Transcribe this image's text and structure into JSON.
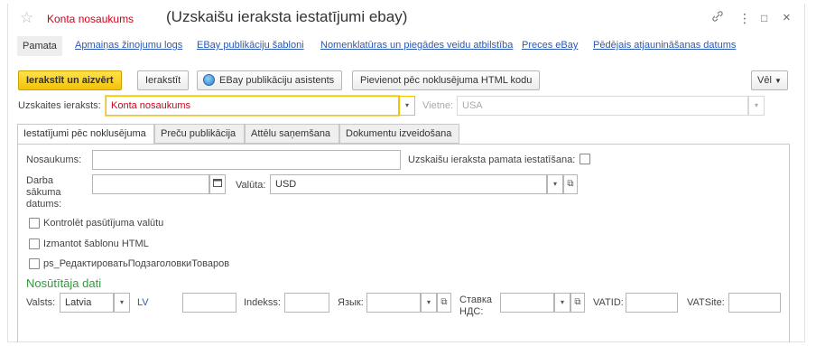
{
  "window": {
    "star_icon": "☆",
    "record_name": "Konta nosaukums",
    "title": "(Uzskaišu ieraksta iestatījumi ebay)",
    "link_icon": "link-icon",
    "more_icon": "⋮",
    "maximize_icon": "□",
    "close_icon": "×"
  },
  "nav": {
    "current": "Pamata",
    "links": [
      "Apmaiņas žinojumu logs",
      "EBay publikāciju šabloni",
      "Nomenklatūras un piegādes veidu atbilstība",
      "Preces eBay",
      "Pēdējais atjaunināšanas datums"
    ]
  },
  "toolbar": {
    "save_close": "Ierakstīt un aizvērt",
    "save": "Ierakstīt",
    "assistant": "EBay publikāciju asistents",
    "add_html": "Pievienot pēc noklusējuma HTML kodu",
    "more": "Vēl"
  },
  "account": {
    "label": "Uzskaites ieraksts:",
    "value": "Konta nosaukums",
    "site_label": "Vietne:",
    "site_value": "USA"
  },
  "tabs": [
    "Iestatījumi pēc noklusējuma",
    "Preču publikācija",
    "Attēlu saņemšana",
    "Dokumentu izveidošana"
  ],
  "form": {
    "name_label": "Nosaukums:",
    "name_value": "",
    "basic_setting_label": "Uzskaišu ieraksta pamata iestatīšana:",
    "start_date_label": "Darba\nsākuma\ndatums:",
    "start_date_value": "",
    "currency_label": "Valūta:",
    "currency_value": "USD",
    "check_currency": "Kontrolēt pasūtījuma valūtu",
    "use_html": "Izmantot šablonu HTML",
    "edit_subtitles": "ps_РедактироватьПодзаголовкиТоваров"
  },
  "sender": {
    "heading": "Nosūtītāja dati",
    "country_label": "Valsts:",
    "country_value": "Latvia",
    "country_code": "LV",
    "index_label": "Indekss:",
    "language_label": "Язык:",
    "vat_rate_label": "Ставка\nНДС:",
    "vatid_label": "VATID:",
    "vatsite_label": "VATSite:"
  }
}
